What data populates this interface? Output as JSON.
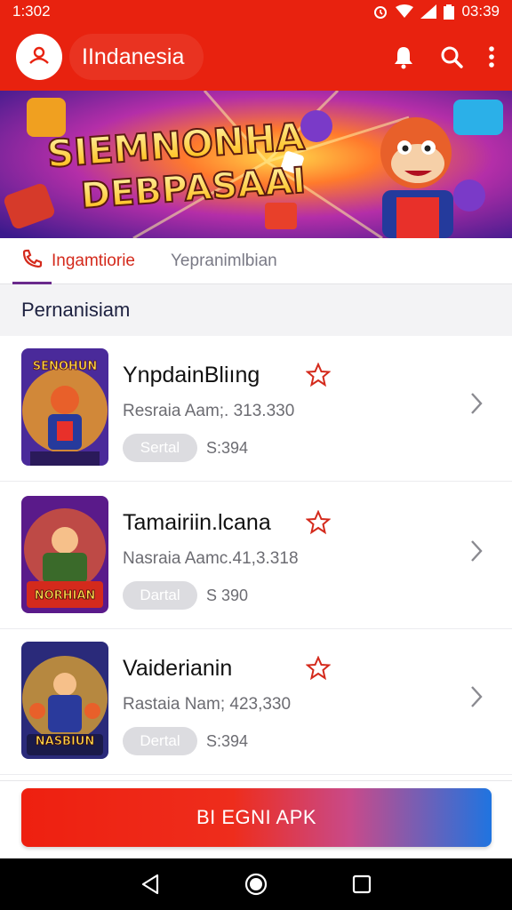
{
  "status_bar": {
    "time": "1:302",
    "right_time": "03:39"
  },
  "app_bar": {
    "title": "IIndanesia"
  },
  "banner": {
    "line1": "SIEMNONHA",
    "line2": "DEBPASAAI"
  },
  "tabs": [
    {
      "label": "Ingamtiorie",
      "active": true
    },
    {
      "label": "Yepranimlbian",
      "active": false
    }
  ],
  "section_title": "Pernanisiam",
  "items": [
    {
      "title": "YnpdainBliıng",
      "subtitle": "Resraia Aam;. 313.330",
      "badge": "Sertal",
      "price": "S:394",
      "thumb_text": "SENOHUN"
    },
    {
      "title": "Tamairiin.lcana",
      "subtitle": "Nasraia Aamc.41,3.318",
      "badge": "Dartal",
      "price": "S 390",
      "thumb_text": "NORHIAN"
    },
    {
      "title": "Vaiderianin",
      "subtitle": "Rastaia Nam; 423,330",
      "badge": "Dertal",
      "price": "S:394",
      "thumb_text": "NASBIUN"
    }
  ],
  "cta": {
    "label": "BI EGNI APK"
  },
  "colors": {
    "brand_red": "#e8220f",
    "cta_blue": "#1f74e0",
    "accent_purple": "#6a2a8c"
  },
  "icons": [
    "profile-icon",
    "bell-icon",
    "search-icon",
    "more-vertical-icon",
    "phone-icon",
    "star-icon",
    "chevron-right-icon",
    "back-icon",
    "home-icon",
    "recents-icon"
  ]
}
